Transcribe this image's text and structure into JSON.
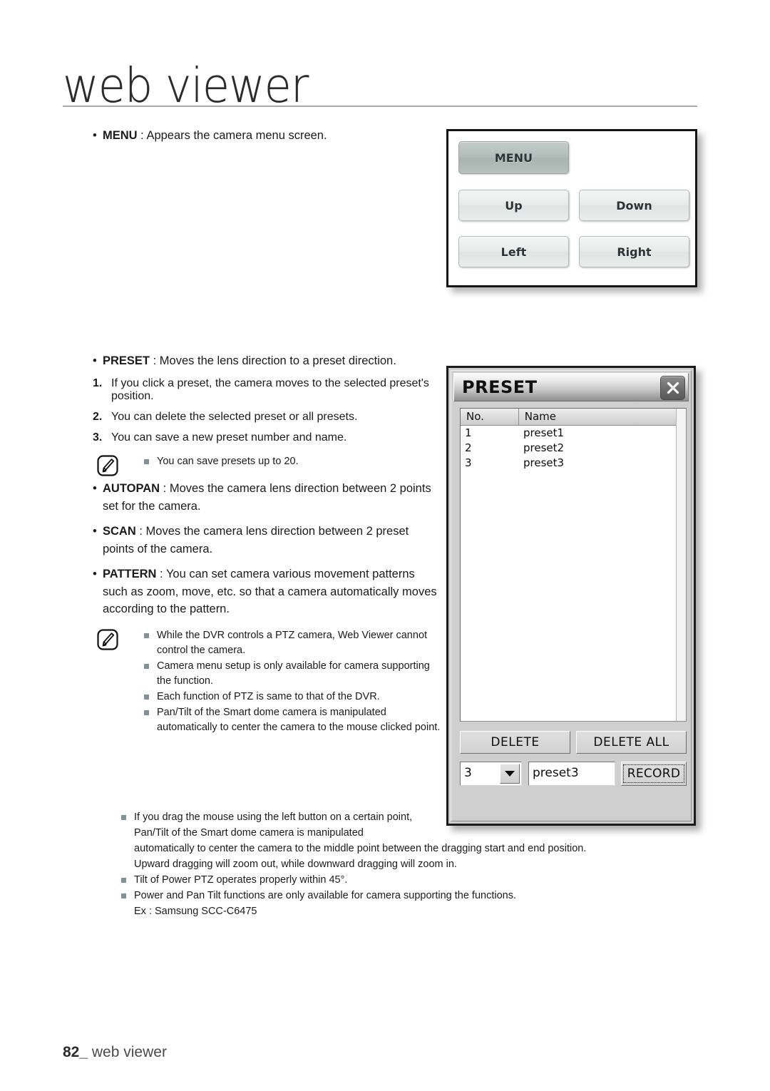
{
  "header": {
    "title": "web viewer"
  },
  "footer": {
    "page_number": "82_",
    "section": "web viewer"
  },
  "left_column": {
    "menu_bullet": {
      "term": "MENU",
      "sep": " : ",
      "text": "Appears the camera menu screen."
    },
    "preset_bullet": {
      "term": "PRESET",
      "sep": " : ",
      "text": "Moves the lens direction to a preset direction."
    },
    "steps": [
      {
        "num": "1.",
        "text": "If you click a preset, the camera moves to the selected preset's position."
      },
      {
        "num": "2.",
        "text": "You can delete the selected preset or all presets."
      },
      {
        "num": "3.",
        "text": "You can save a new preset number and name."
      }
    ],
    "note_preset": {
      "icon": "note-pencil-icon",
      "items": [
        "You can save presets up to 20."
      ]
    },
    "autopan_bullet": {
      "term": "AUTOPAN",
      "sep": " : ",
      "text": "Moves the camera lens direction between 2 points set for the camera."
    },
    "scan_bullet": {
      "term": "SCAN",
      "sep": " : ",
      "text": "Moves the camera lens direction between 2 preset points of the camera."
    },
    "pattern_bullet": {
      "term": "PATTERN",
      "sep": " : ",
      "text": "You can set camera various movement patterns such as zoom, move, etc. so that a camera automatically moves according to the pattern."
    },
    "note_ptz": {
      "icon": "note-pencil-icon",
      "items": [
        "While the DVR controls a PTZ camera, Web Viewer cannot control the camera.",
        "Camera menu setup is only available for camera supporting the function.",
        "Each function of PTZ is same to that of the DVR.",
        "Pan/Tilt of the Smart dome camera is manipulated automatically to center the camera to the mouse clicked point."
      ]
    },
    "note_ptz_wide": {
      "item_drag_line1": "If you drag the mouse using the left button on a certain point,",
      "item_drag_line2": "Pan/Tilt of the Smart dome camera is manipulated",
      "item_drag_line3": "automatically to center the camera to the middle point between the dragging start and end position.",
      "item_drag_line4": "Upward dragging will zoom out, while downward dragging will zoom in.",
      "item_tilt": "Tilt of Power PTZ operates properly within 45°.",
      "item_power": "Power and Pan Tilt functions are only available for camera supporting the functions.",
      "item_power_ex": "Ex : Samsung SCC-C6475"
    }
  },
  "menu_panel": {
    "buttons": [
      {
        "label": "MENU",
        "state": "active"
      },
      {
        "label": "Up",
        "state": "normal"
      },
      {
        "label": "Down",
        "state": "normal"
      },
      {
        "label": "Left",
        "state": "normal"
      },
      {
        "label": "Right",
        "state": "normal"
      }
    ],
    "colors": {
      "active": "#b2bdb9",
      "normal": "#e7ecea",
      "border": "#141414"
    }
  },
  "preset_dialog": {
    "title": "PRESET",
    "close_icon": "close-x-icon",
    "table": {
      "columns": [
        "No.",
        "Name"
      ],
      "rows": [
        {
          "no": "1",
          "name": "preset1"
        },
        {
          "no": "2",
          "name": "preset2"
        },
        {
          "no": "3",
          "name": "preset3"
        }
      ]
    },
    "delete_label": "DELETE",
    "delete_all_label": "DELETE ALL",
    "number_select": {
      "value": "3",
      "icon": "chevron-down-icon"
    },
    "name_input": {
      "value": "preset3"
    },
    "record_label": "RECORD"
  }
}
